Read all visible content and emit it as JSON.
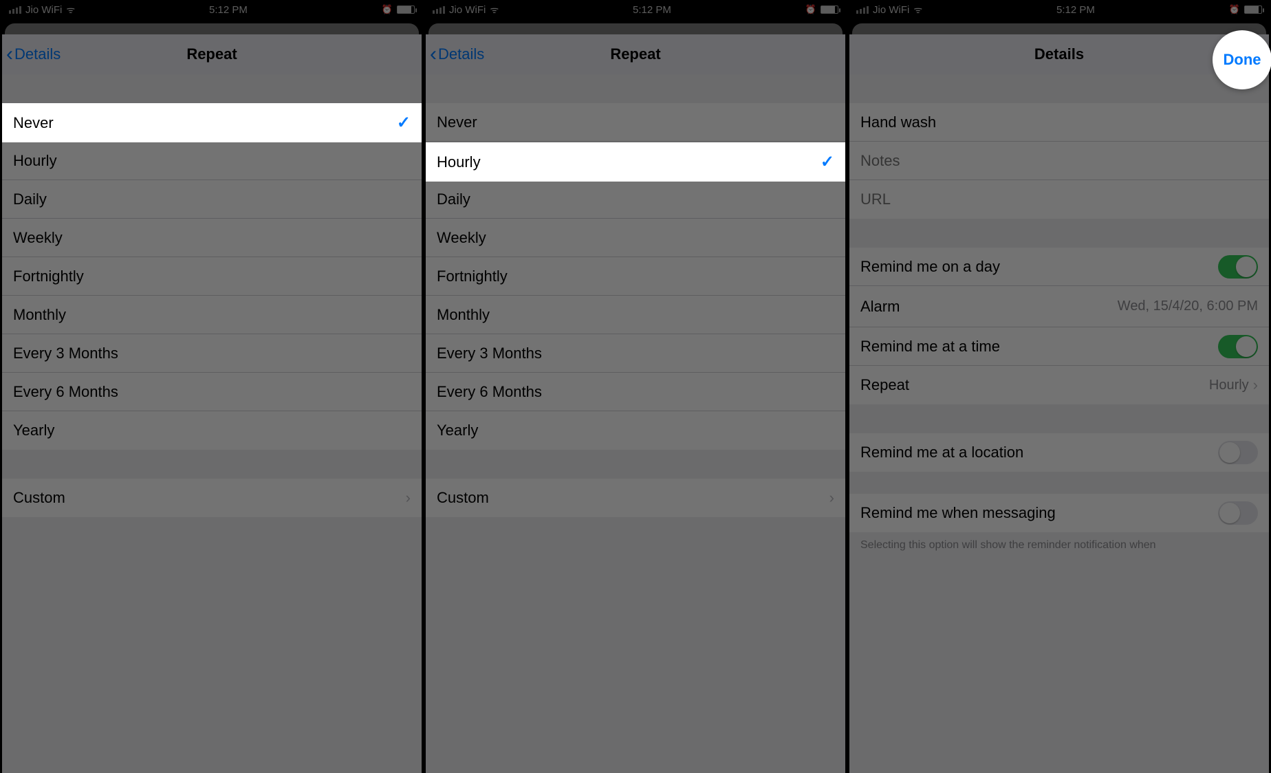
{
  "statusbar": {
    "carrier": "Jio WiFi",
    "time": "5:12 PM"
  },
  "phone1": {
    "back_label": "Details",
    "title": "Repeat",
    "selected_index": 0,
    "options": [
      "Never",
      "Hourly",
      "Daily",
      "Weekly",
      "Fortnightly",
      "Monthly",
      "Every 3 Months",
      "Every 6 Months",
      "Yearly"
    ],
    "custom_label": "Custom"
  },
  "phone2": {
    "back_label": "Details",
    "title": "Repeat",
    "selected_index": 1,
    "options": [
      "Never",
      "Hourly",
      "Daily",
      "Weekly",
      "Fortnightly",
      "Monthly",
      "Every 3 Months",
      "Every 6 Months",
      "Yearly"
    ],
    "custom_label": "Custom"
  },
  "phone3": {
    "title": "Details",
    "done_label": "Done",
    "reminder_title": "Hand wash",
    "notes_placeholder": "Notes",
    "url_placeholder": "URL",
    "remind_day_label": "Remind me on a day",
    "remind_day_on": true,
    "alarm_label": "Alarm",
    "alarm_value": "Wed, 15/4/20, 6:00 PM",
    "remind_time_label": "Remind me at a time",
    "remind_time_on": true,
    "repeat_label": "Repeat",
    "repeat_value": "Hourly",
    "remind_location_label": "Remind me at a location",
    "remind_location_on": false,
    "remind_messaging_label": "Remind me when messaging",
    "remind_messaging_on": false,
    "footnote": "Selecting this option will show the reminder notification when"
  }
}
